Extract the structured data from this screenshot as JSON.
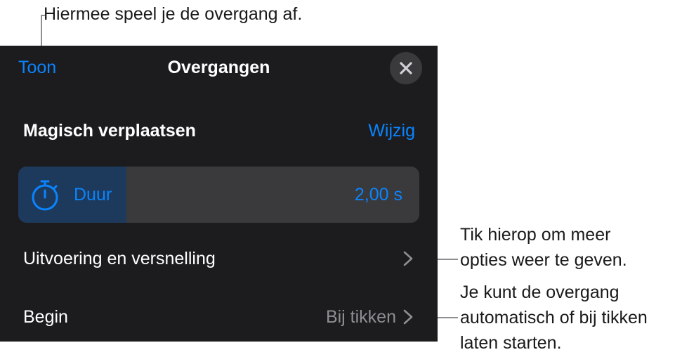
{
  "callouts": {
    "play": "Hiermee speel je de overgang af.",
    "more_line1": "Tik hierop om meer",
    "more_line2": "opties weer te geven.",
    "start_line1": "Je kunt de overgang",
    "start_line2": "automatisch of bij tikken",
    "start_line3": "laten starten."
  },
  "nav": {
    "show_label": "Toon",
    "title": "Overgangen",
    "close_icon": "close-icon"
  },
  "transition": {
    "name": "Magisch verplaatsen",
    "edit_label": "Wijzig"
  },
  "duration": {
    "icon": "stopwatch-icon",
    "label": "Duur",
    "value": "2,00 s",
    "fill_fraction": 0.27
  },
  "rows": {
    "timing": {
      "label": "Uitvoering en versnelling",
      "icon": "chevron-right-icon"
    },
    "start": {
      "label": "Begin",
      "value": "Bij tikken",
      "icon": "chevron-right-icon"
    }
  },
  "colors": {
    "accent": "#0a84ff",
    "panel_bg": "#1c1c1e",
    "control_bg": "#3a3a3c",
    "fill": "#1d3a5c",
    "secondary_text": "#8e8e93"
  }
}
